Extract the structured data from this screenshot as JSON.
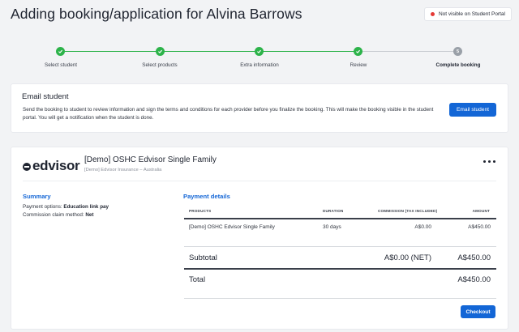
{
  "header": {
    "title": "Adding booking/application for Alvina Barrows",
    "visibility_badge": "Not visible on Student Portal",
    "badge_color": "#e53935"
  },
  "stepper": {
    "steps": [
      {
        "label": "Select student",
        "status": "done"
      },
      {
        "label": "Select products",
        "status": "done"
      },
      {
        "label": "Extra information",
        "status": "done"
      },
      {
        "label": "Review",
        "status": "done"
      },
      {
        "label": "Complete booking",
        "status": "current",
        "number": "5"
      }
    ],
    "done_color": "#2db34a"
  },
  "email_section": {
    "title": "Email student",
    "description": "Send the booking to student to review information and sign the terms and conditions for each provider before you finalize the booking. This will make the booking visible in the student portal. You will get a notification when the student is done.",
    "button_label": "Email student"
  },
  "product": {
    "logo_text": "edvisor",
    "name": "[Demo] OSHC Edvisor Single Family",
    "provider": "[Demo] Edvisor Insurance – Australia"
  },
  "summary": {
    "title": "Summary",
    "payment_options_label": "Payment options:",
    "payment_options_value": "Education link pay",
    "commission_label": "Commission claim method:",
    "commission_value": "Net"
  },
  "payment_details": {
    "title": "Payment details",
    "columns": [
      "PRODUCTS",
      "DURATION",
      "COMMISSION (TAX INCLUDED)",
      "AMOUNT"
    ],
    "rows": [
      {
        "product": "[Demo] OSHC Edvisor Single Family",
        "duration": "30 days",
        "commission": "A$0.00",
        "amount": "A$450.00"
      }
    ],
    "subtotal_label": "Subtotal",
    "subtotal_commission": "A$0.00 (NET)",
    "subtotal_amount": "A$450.00",
    "total_label": "Total",
    "total_amount": "A$450.00",
    "checkout_label": "Checkout"
  },
  "accent_color": "#1366d6"
}
